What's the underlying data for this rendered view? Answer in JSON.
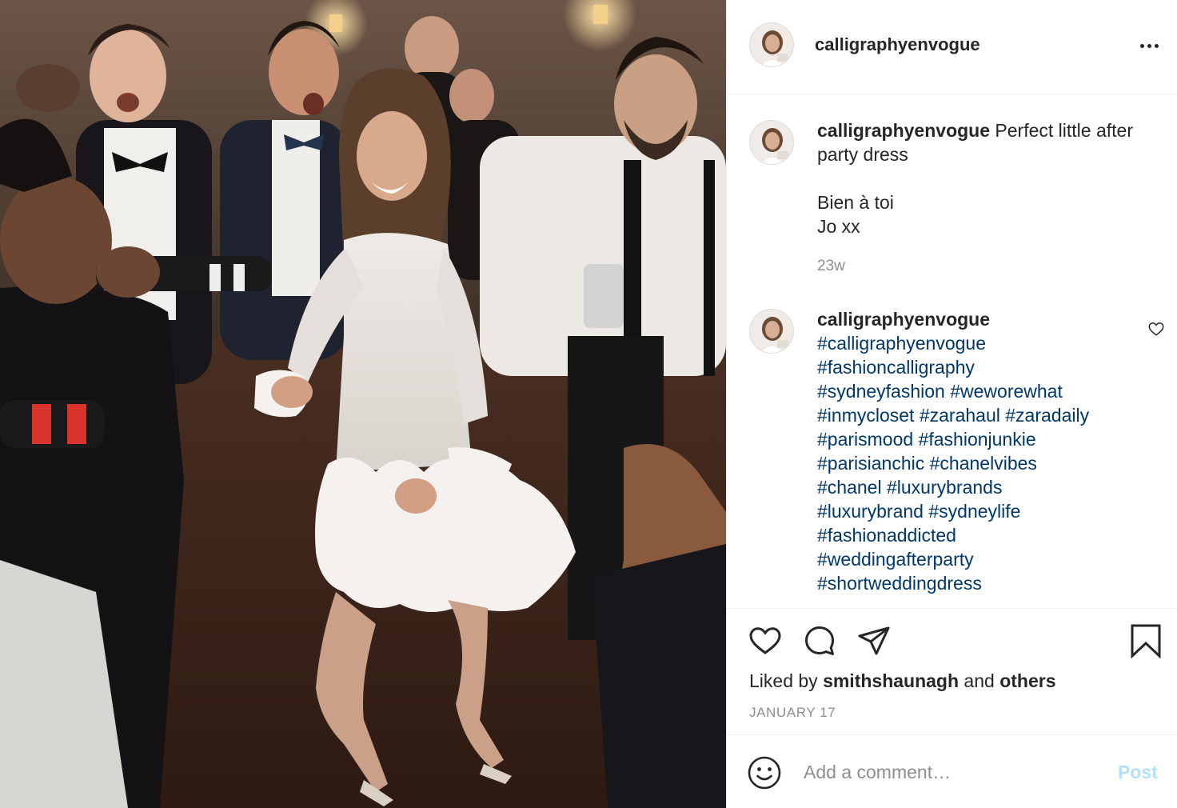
{
  "post": {
    "username": "calligraphyenvogue",
    "caption_user": "calligraphyenvogue",
    "caption_lines": [
      "Perfect little after",
      "party dress"
    ],
    "caption_signoff": [
      "Bien à toi",
      "Jo xx"
    ],
    "caption_time": "23w"
  },
  "hashtag_comment": {
    "username": "calligraphyenvogue",
    "rows": [
      [
        "#calligraphyenvogue"
      ],
      [
        "#fashioncalligraphy"
      ],
      [
        "#sydneyfashion",
        "#weworewhat"
      ],
      [
        "#inmycloset",
        "#zarahaul",
        "#zaradaily"
      ],
      [
        "#parismood",
        "#fashionjunkie"
      ],
      [
        "#parisianchic",
        "#chanelvibes"
      ],
      [
        "#chanel",
        "#luxurybrands"
      ],
      [
        "#luxurybrand",
        "#sydneylife"
      ],
      [
        "#fashionaddicted"
      ],
      [
        "#weddingafterparty"
      ],
      [
        "#shortweddingdress"
      ]
    ]
  },
  "likes": {
    "prefix": "Liked by",
    "user": "smithshaunagh",
    "joiner": "and",
    "others": "others"
  },
  "date": "JANUARY 17",
  "comment_box": {
    "placeholder": "Add a comment…",
    "post_label": "Post"
  },
  "icons": {
    "more": "more-horizontal-icon",
    "like": "heart-icon",
    "comment": "speech-bubble-icon",
    "share": "paper-plane-icon",
    "save": "bookmark-icon",
    "emoji": "smiley-icon"
  },
  "colors": {
    "text": "#262626",
    "muted": "#8e8e8e",
    "hashtag": "#00376b",
    "post_button_disabled": "#b2dffc",
    "divider": "#efefef"
  }
}
